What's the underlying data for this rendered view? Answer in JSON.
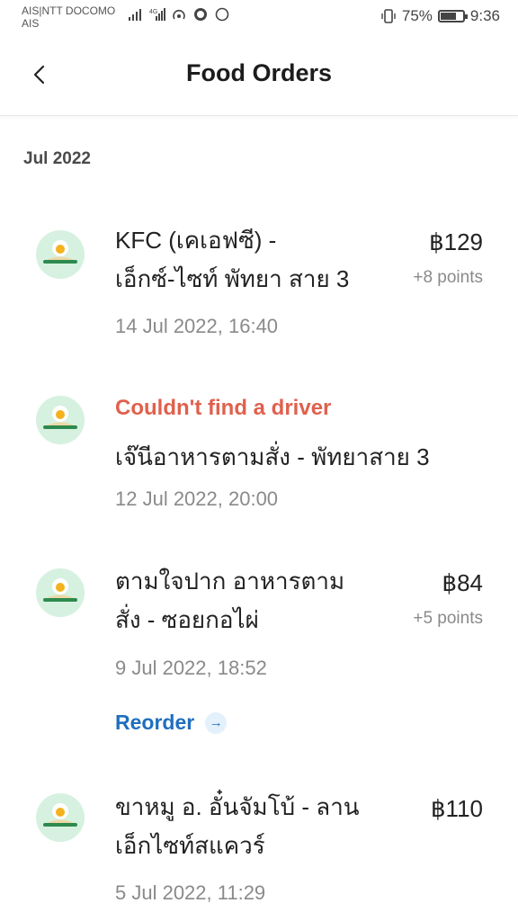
{
  "status_bar": {
    "carrier_line1": "AIS|NTT DOCOMO",
    "carrier_line2": "AIS",
    "battery_percent": "75%",
    "battery_level": 0.75,
    "time": "9:36"
  },
  "header": {
    "title": "Food Orders"
  },
  "section": {
    "month": "Jul 2022"
  },
  "orders": [
    {
      "name_line1": "KFC (เคเอฟซี) -",
      "name_line2": "เอ็กซ์-ไซท์ พัทยา สาย 3",
      "price": "฿129",
      "points": "+8 points",
      "date": "14 Jul 2022, 16:40"
    },
    {
      "status": "Couldn't find a driver",
      "name_line1": "เจ๊นีอาหารตามสั่ง - พัทยาสาย 3",
      "date": "12 Jul 2022, 20:00"
    },
    {
      "name_line1": "ตามใจปาก อาหารตาม",
      "name_line2": "สั่ง - ซอยกอไผ่",
      "price": "฿84",
      "points": "+5 points",
      "date": "9 Jul 2022, 18:52",
      "reorder_label": "Reorder"
    },
    {
      "name_line1": "ขาหมู อ. อั๋นจัมโบ้ - ลาน",
      "name_line2": "เอ็กไซท์สแควร์",
      "price": "฿110",
      "date": "5 Jul 2022, 11:29"
    }
  ],
  "icons": {
    "back": "chevron-left-icon",
    "food": "food-plate-icon",
    "reorder_arrow": "arrow-right-icon"
  },
  "colors": {
    "status_error": "#e0604d",
    "link": "#1f6fbf",
    "icon_bg": "#d6f1e0"
  }
}
